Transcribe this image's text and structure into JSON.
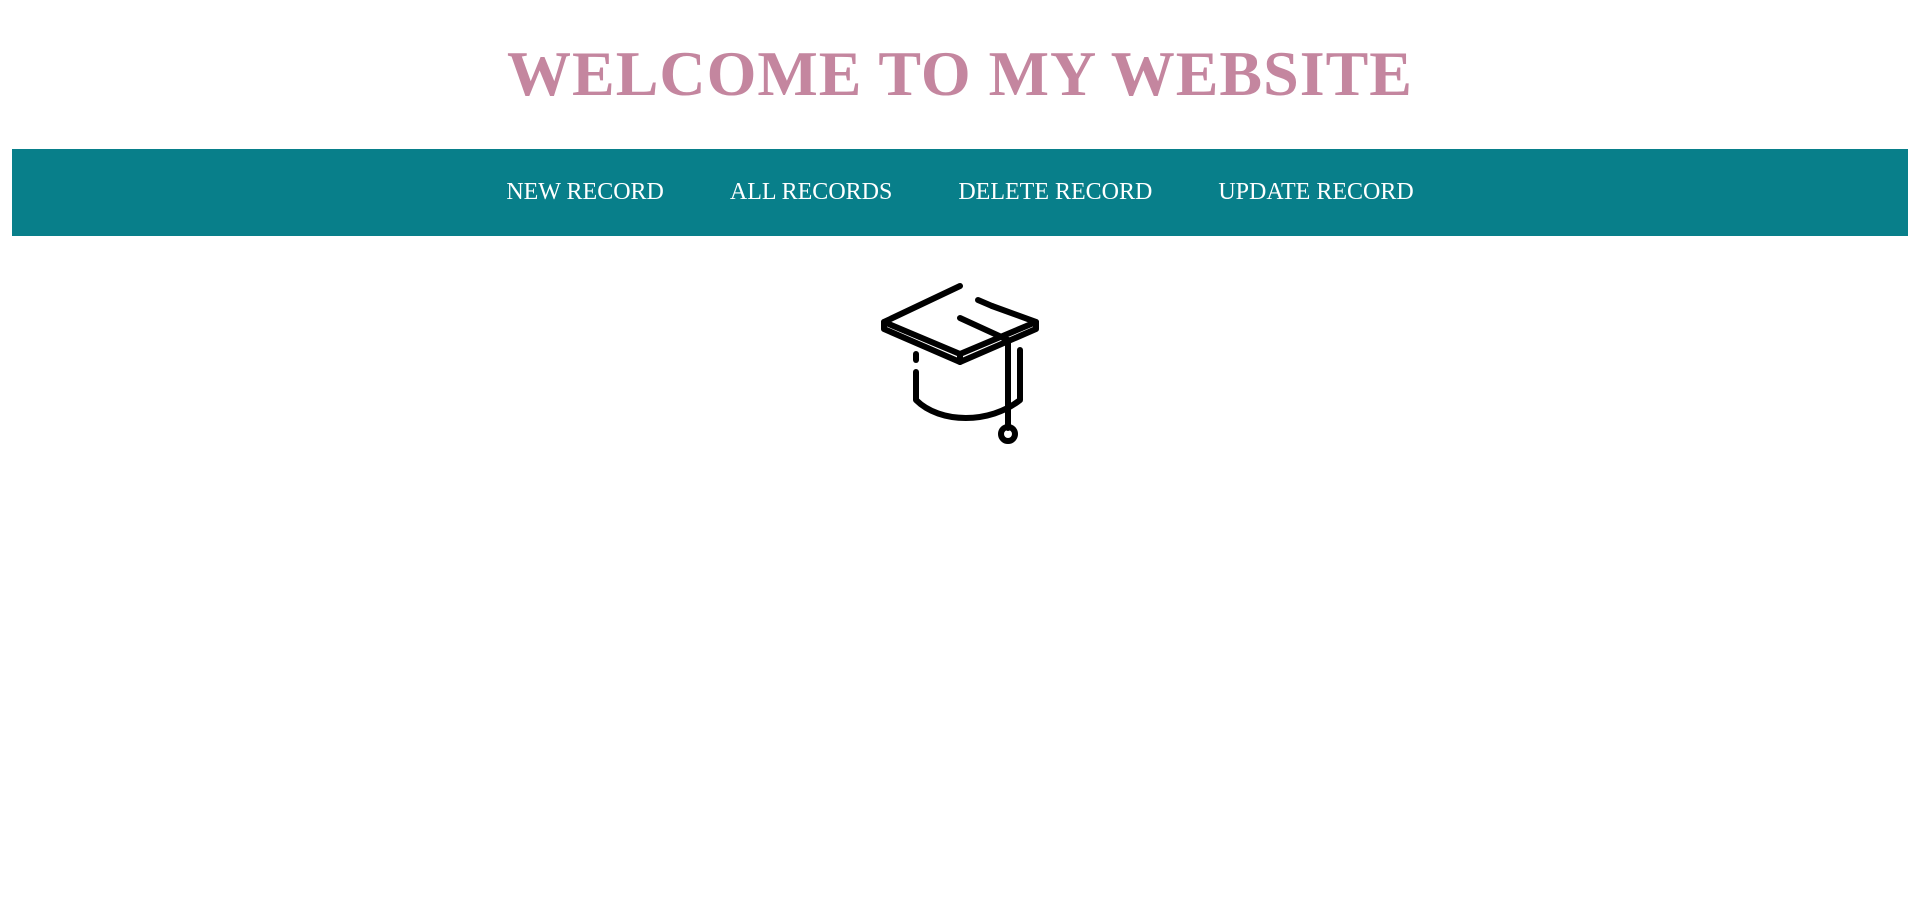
{
  "header": {
    "title": "WELCOME TO MY WEBSITE"
  },
  "nav": {
    "items": [
      {
        "label": "NEW RECORD"
      },
      {
        "label": "ALL RECORDS"
      },
      {
        "label": "DELETE RECORD"
      },
      {
        "label": "UPDATE RECORD"
      }
    ]
  },
  "logo": {
    "icon": "graduation-cap-icon"
  },
  "colors": {
    "title": "#c4869f",
    "navbar_background": "#087f8a",
    "nav_text": "#ffffff",
    "icon_stroke": "#000000"
  }
}
